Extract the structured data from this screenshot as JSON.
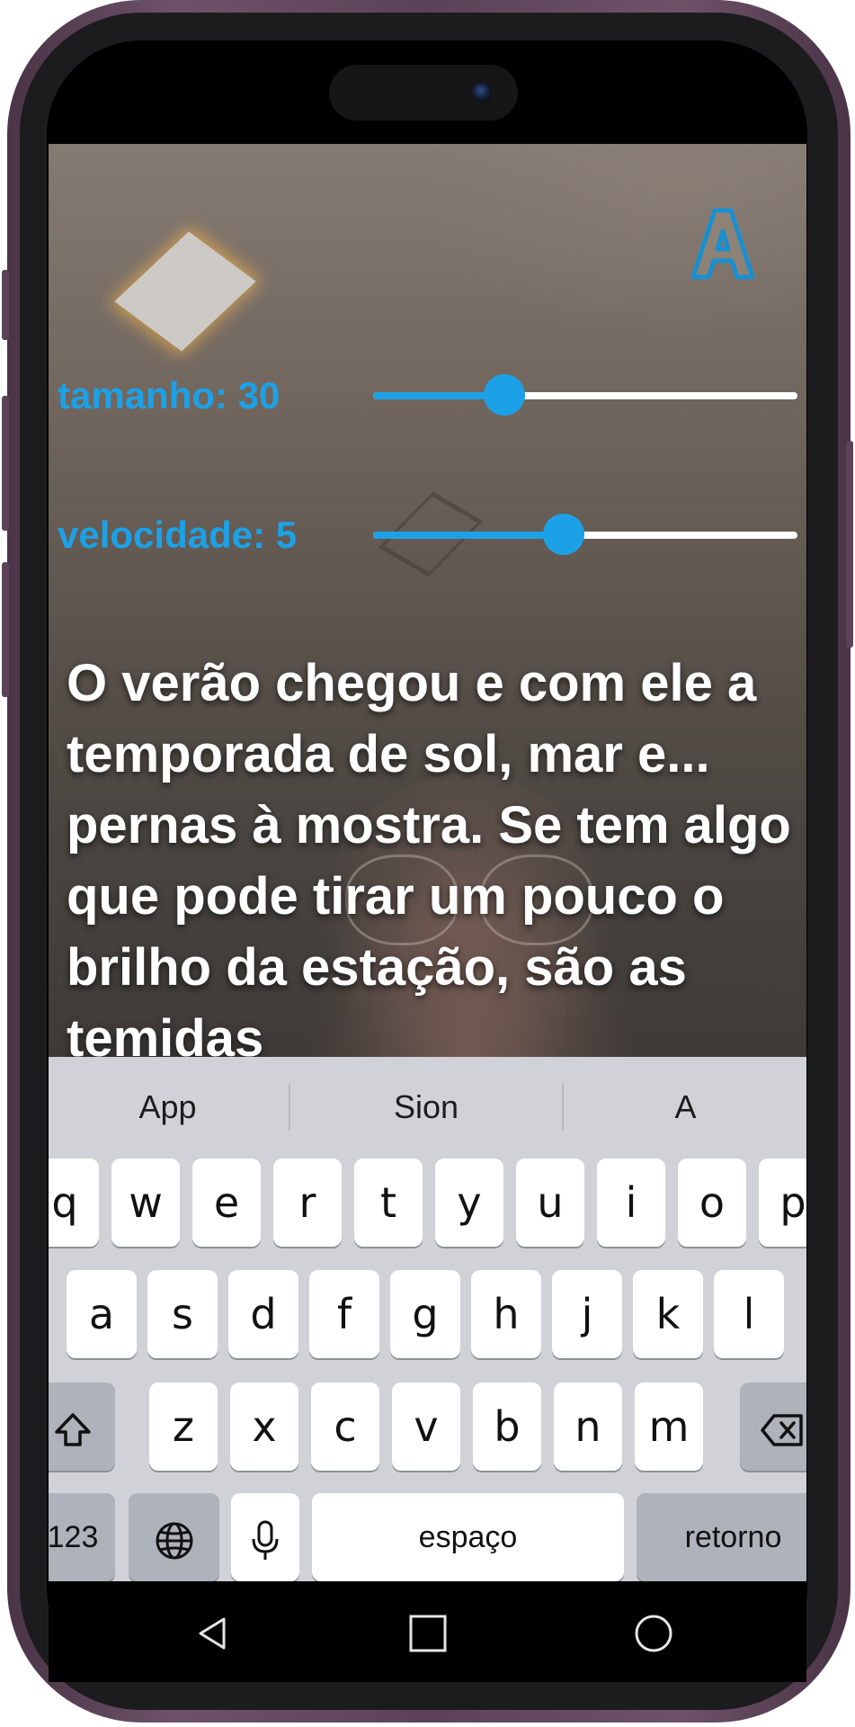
{
  "app": {
    "accent_color": "#1da1e6",
    "logo_icon": "letter-a-icon",
    "size_slider": {
      "label": "tamanho: 30",
      "value": 30,
      "fraction": 0.31
    },
    "speed_slider": {
      "label": "velocidade: 5",
      "value": 5,
      "fraction": 0.45
    },
    "prompter_text": "O verão chegou e com ele a temporada de sol, mar e... pernas à mostra. Se tem algo que pode tirar um pouco o brilho da estação, são as temidas"
  },
  "keyboard": {
    "suggestions": [
      "App",
      "Sion",
      "A"
    ],
    "row1": [
      "q",
      "w",
      "e",
      "r",
      "t",
      "y",
      "u",
      "i",
      "o",
      "p"
    ],
    "row2": [
      "a",
      "s",
      "d",
      "f",
      "g",
      "h",
      "j",
      "k",
      "l"
    ],
    "row3": [
      "z",
      "x",
      "c",
      "v",
      "b",
      "n",
      "m"
    ],
    "numbers_key": "123",
    "space_key": "espaço",
    "return_key": "retorno",
    "shift_icon": "shift-icon",
    "backspace_icon": "backspace-icon",
    "globe_icon": "globe-icon",
    "mic_icon": "microphone-icon"
  },
  "navbar": {
    "back_icon": "back-triangle-icon",
    "home_icon": "home-square-icon",
    "recents_icon": "recents-circle-icon"
  }
}
